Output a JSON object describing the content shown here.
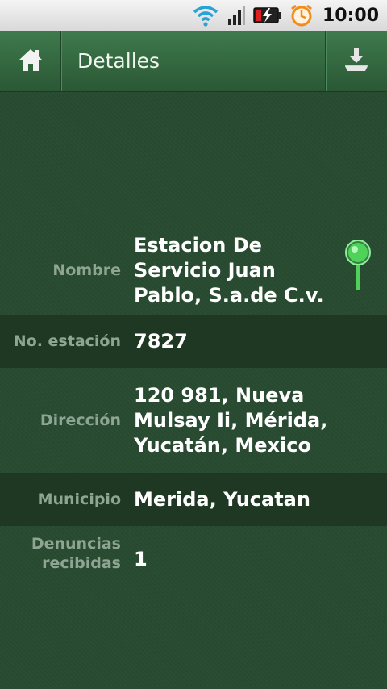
{
  "status_bar": {
    "time": "10:00",
    "icons": [
      "wifi-icon",
      "signal-icon",
      "battery-charging-icon",
      "alarm-icon"
    ]
  },
  "action_bar": {
    "title": "Detalles",
    "home_icon": "home-icon",
    "download_icon": "download-icon"
  },
  "details": [
    {
      "label": "Nombre",
      "value": "Estacion De Servicio Juan Pablo, S.a.de C.v."
    },
    {
      "label": "No. estación",
      "value": "7827"
    },
    {
      "label": "Dirección",
      "value": "120 981, Nueva Mulsay Ii, Mérida, Yucatán, Mexico"
    },
    {
      "label": "Municipio",
      "value": "Merida, Yucatan"
    },
    {
      "label": "Denuncias recibidas",
      "value": "1"
    }
  ],
  "colors": {
    "background": "#284a30",
    "row_alt": "#1e3823",
    "label": "#8fa593",
    "value": "#ffffff",
    "pin": "#4fd25a"
  }
}
